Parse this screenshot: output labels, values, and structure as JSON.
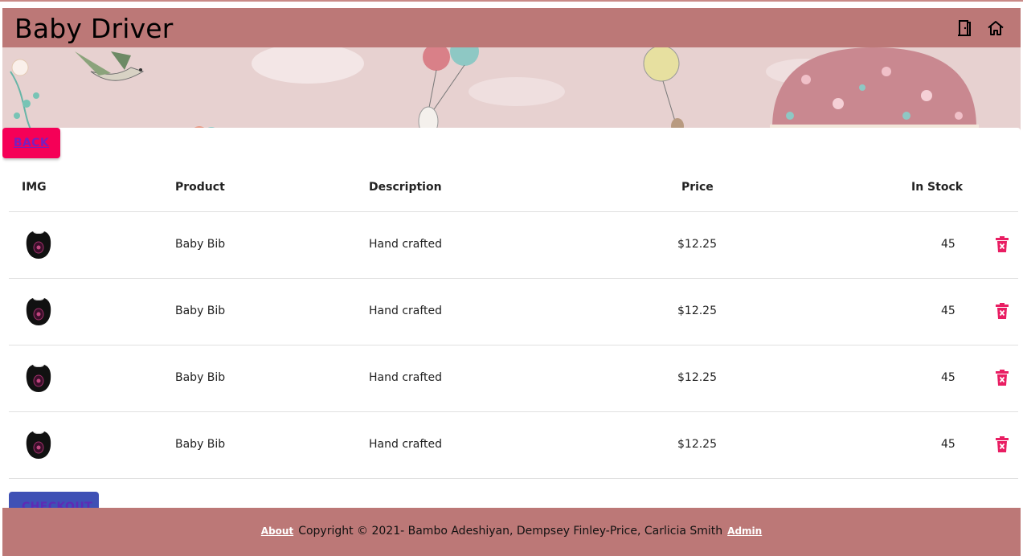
{
  "header": {
    "title": "Baby Driver",
    "icons": [
      "door-icon",
      "home-icon"
    ]
  },
  "actions": {
    "back_label": "BACK",
    "checkout_label": "CHECKOUT"
  },
  "table": {
    "columns": [
      "IMG",
      "Product",
      "Description",
      "Price",
      "In Stock"
    ],
    "rows": [
      {
        "product": "Baby Bib",
        "description": "Hand crafted",
        "price": "$12.25",
        "stock": "45"
      },
      {
        "product": "Baby Bib",
        "description": "Hand crafted",
        "price": "$12.25",
        "stock": "45"
      },
      {
        "product": "Baby Bib",
        "description": "Hand crafted",
        "price": "$12.25",
        "stock": "45"
      },
      {
        "product": "Baby Bib",
        "description": "Hand crafted",
        "price": "$12.25",
        "stock": "45"
      }
    ]
  },
  "footer": {
    "about": "About",
    "copyright": "Copyright © 2021- Bambo Adeshiyan, Dempsey Finley-Price, Carlicia Smith",
    "admin": "Admin"
  },
  "colors": {
    "appbar": "#bc7877",
    "back_button": "#f50057",
    "checkout_button": "#3f51b5",
    "delete_icon": "#e91e63"
  }
}
